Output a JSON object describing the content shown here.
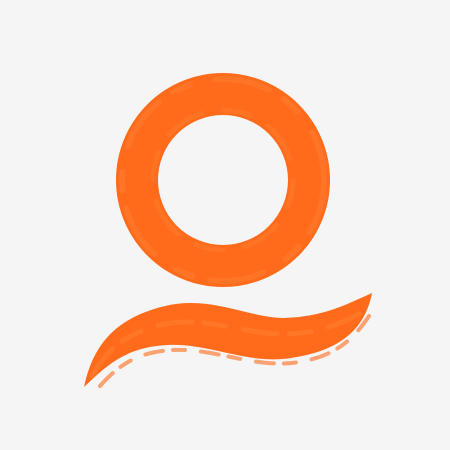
{
  "logo": {
    "icon": "ring-and-wave-brush-logo-icon",
    "color": "#ff6b1a"
  },
  "background": {
    "color": "#f5f5f5"
  }
}
